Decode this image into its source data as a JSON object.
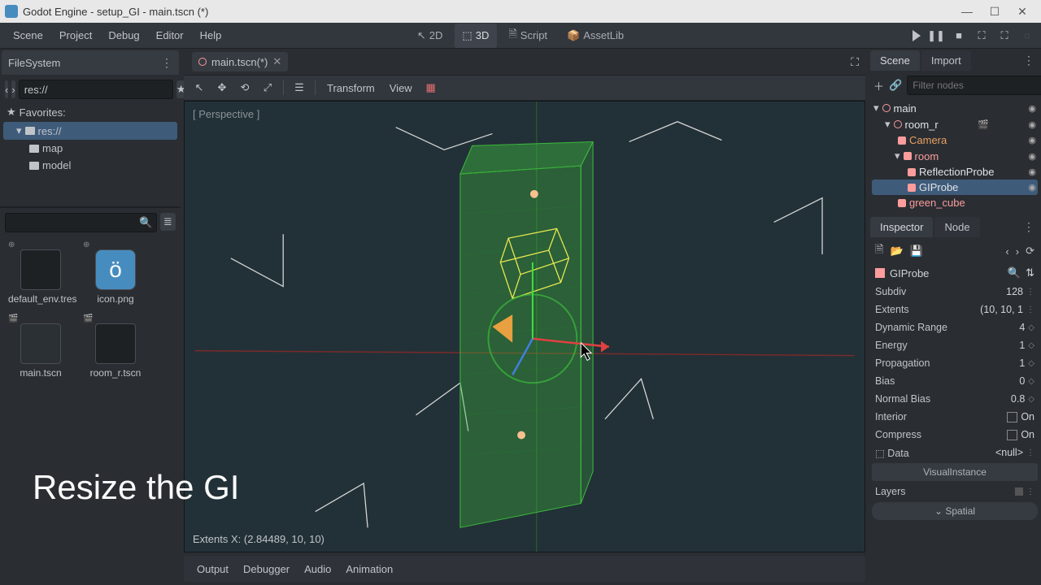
{
  "window": {
    "title": "Godot Engine - setup_GI - main.tscn (*)"
  },
  "menu": {
    "scene": "Scene",
    "project": "Project",
    "debug": "Debug",
    "editor": "Editor",
    "help": "Help"
  },
  "workspace": {
    "b2d": "2D",
    "b3d": "3D",
    "script": "Script",
    "assetlib": "AssetLib"
  },
  "filesystem": {
    "title": "FileSystem",
    "path": "res://",
    "favorites": "Favorites:",
    "root": "res://",
    "folders": [
      "map",
      "model"
    ],
    "files": [
      {
        "name": "default_env.tres"
      },
      {
        "name": "icon.png"
      },
      {
        "name": "main.tscn"
      },
      {
        "name": "room_r.tscn"
      }
    ]
  },
  "tab": {
    "name": "main.tscn(*)"
  },
  "toolbar3d": {
    "transform": "Transform",
    "view": "View"
  },
  "viewport": {
    "label": "[ Perspective ]",
    "status": "Extents X: (2.84489, 10, 10)"
  },
  "bottom": {
    "output": "Output",
    "debugger": "Debugger",
    "audio": "Audio",
    "animation": "Animation"
  },
  "scene_dock": {
    "tab_scene": "Scene",
    "tab_import": "Import",
    "filter_placeholder": "Filter nodes",
    "tree": {
      "root": "main",
      "room_r": "room_r",
      "camera": "Camera",
      "room": "room",
      "reflection": "ReflectionProbe",
      "giprobe": "GIProbe",
      "green_cube": "green_cube"
    }
  },
  "inspector": {
    "tab_inspector": "Inspector",
    "tab_node": "Node",
    "object": "GIProbe",
    "props": {
      "subdiv": {
        "l": "Subdiv",
        "v": "128"
      },
      "extents": {
        "l": "Extents",
        "v": "(10, 10, 1"
      },
      "dynamic_range": {
        "l": "Dynamic Range",
        "v": "4"
      },
      "energy": {
        "l": "Energy",
        "v": "1"
      },
      "propagation": {
        "l": "Propagation",
        "v": "1"
      },
      "bias": {
        "l": "Bias",
        "v": "0"
      },
      "normal_bias": {
        "l": "Normal Bias",
        "v": "0.8"
      },
      "interior": {
        "l": "Interior",
        "v": "On"
      },
      "compress": {
        "l": "Compress",
        "v": "On"
      },
      "data": {
        "l": "Data",
        "v": "<null>"
      }
    },
    "visualinstance": "VisualInstance",
    "layers": "Layers",
    "spatial": "Spatial"
  },
  "caption": "Resize the GI"
}
